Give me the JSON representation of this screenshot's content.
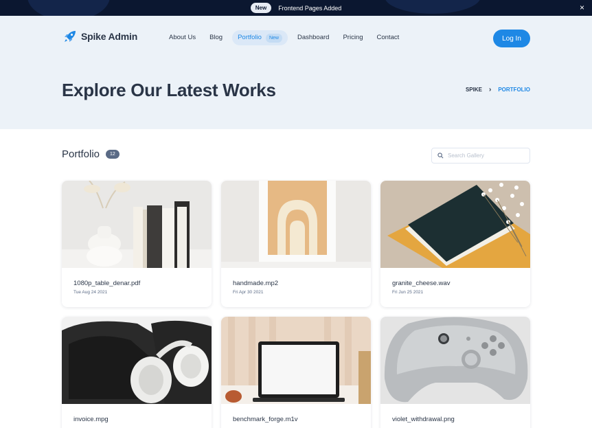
{
  "announcement": {
    "badge": "New",
    "message": "Frontend Pages Added",
    "close_glyph": "×"
  },
  "brand": {
    "name": "Spike Admin",
    "color": "#1e88e5"
  },
  "nav": {
    "items": [
      {
        "label": "About Us"
      },
      {
        "label": "Blog"
      },
      {
        "label": "Portfolio",
        "badge": "New",
        "active": true
      },
      {
        "label": "Dashboard"
      },
      {
        "label": "Pricing"
      },
      {
        "label": "Contact"
      }
    ],
    "login_label": "Log In"
  },
  "hero": {
    "title": "Explore Our Latest Works",
    "breadcrumb": [
      "SPIKE",
      "PORTFOLIO"
    ],
    "breadcrumb_separator": "›"
  },
  "portfolio": {
    "title": "Portfolio",
    "count": "12",
    "search_placeholder": "Search Gallery",
    "items": [
      {
        "name": "1080p_table_denar.pdf",
        "date": "Tue Aug 24 2021",
        "image": "vase-books"
      },
      {
        "name": "handmade.mp2",
        "date": "Fri Apr 30 2021",
        "image": "framed-arch-art"
      },
      {
        "name": "granite_cheese.wav",
        "date": "Fri Jun 25 2021",
        "image": "book-with-flowers"
      },
      {
        "name": "invoice.mpg",
        "date": "",
        "image": "headphones-case"
      },
      {
        "name": "benchmark_forge.m1v",
        "date": "",
        "image": "laptop-desk"
      },
      {
        "name": "violet_withdrawal.png",
        "date": "",
        "image": "game-controller"
      }
    ]
  },
  "colors": {
    "accent": "#1e88e5",
    "dark": "#2a3547",
    "hero_bg": "#ecf2f8",
    "topbar_bg": "#0b1730"
  }
}
